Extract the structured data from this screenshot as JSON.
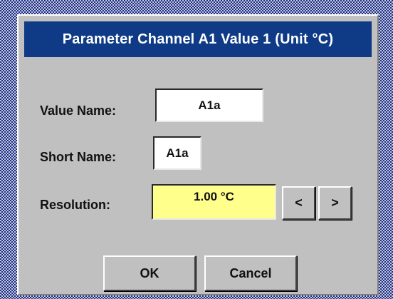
{
  "dialog": {
    "title": "Parameter Channel A1 Value 1 (Unit °C)"
  },
  "fields": {
    "value_name_label": "Value Name:",
    "value_name_value": "A1a",
    "short_name_label": "Short Name:",
    "short_name_value": "A1a",
    "resolution_label": "Resolution:",
    "resolution_value": "1.00 °C",
    "decrease_label": "<",
    "increase_label": ">"
  },
  "buttons": {
    "ok_label": "OK",
    "cancel_label": "Cancel"
  },
  "colors": {
    "titlebar": "#0e3a86",
    "dialog_bg": "#c0c0c0",
    "resolution_field_bg": "#ffff8c"
  }
}
